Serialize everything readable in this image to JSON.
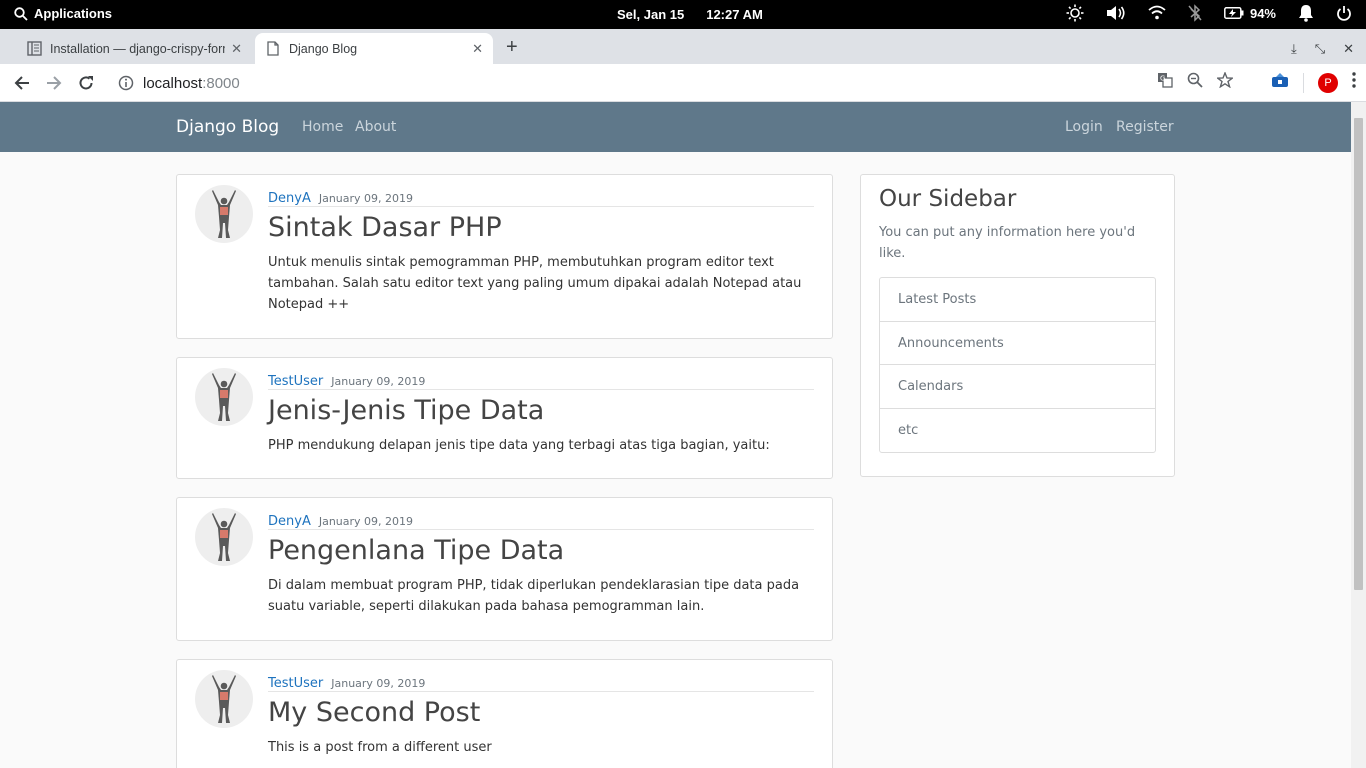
{
  "system_bar": {
    "apps_label": "Applications",
    "date": "Sel, Jan 15",
    "time": "12:27 AM",
    "battery": "94%"
  },
  "browser": {
    "tabs": [
      {
        "title": "Installation — django-crispy-forms",
        "active": false
      },
      {
        "title": "Django Blog",
        "active": true
      }
    ],
    "url_host": "localhost",
    "url_port": ":8000",
    "profile_initial": "P"
  },
  "site": {
    "brand": "Django Blog",
    "nav_left": [
      "Home",
      "About"
    ],
    "nav_right": [
      "Login",
      "Register"
    ]
  },
  "posts": [
    {
      "author": "DenyA",
      "date": "January 09, 2019",
      "title": "Sintak Dasar PHP",
      "content": "Untuk menulis sintak pemogramman PHP, membutuhkan program editor text tambahan. Salah satu editor text yang paling umum dipakai adalah Notepad atau Notepad ++"
    },
    {
      "author": "TestUser",
      "date": "January 09, 2019",
      "title": "Jenis-Jenis Tipe Data",
      "content": "PHP mendukung delapan jenis tipe data yang terbagi atas tiga bagian, yaitu:"
    },
    {
      "author": "DenyA",
      "date": "January 09, 2019",
      "title": "Pengenlana Tipe Data",
      "content": "Di dalam membuat program PHP, tidak diperlukan pendeklarasian tipe data pada suatu variable, seperti dilakukan pada bahasa pemogramman lain."
    },
    {
      "author": "TestUser",
      "date": "January 09, 2019",
      "title": "My Second Post",
      "content": "This is a post from a different user"
    }
  ],
  "sidebar": {
    "title": "Our Sidebar",
    "description": "You can put any information here you'd like.",
    "items": [
      "Latest Posts",
      "Announcements",
      "Calendars",
      "etc"
    ]
  },
  "colors": {
    "navbar": "#5f788a",
    "author_link": "#1e73be",
    "profile_badge": "#e00000"
  }
}
